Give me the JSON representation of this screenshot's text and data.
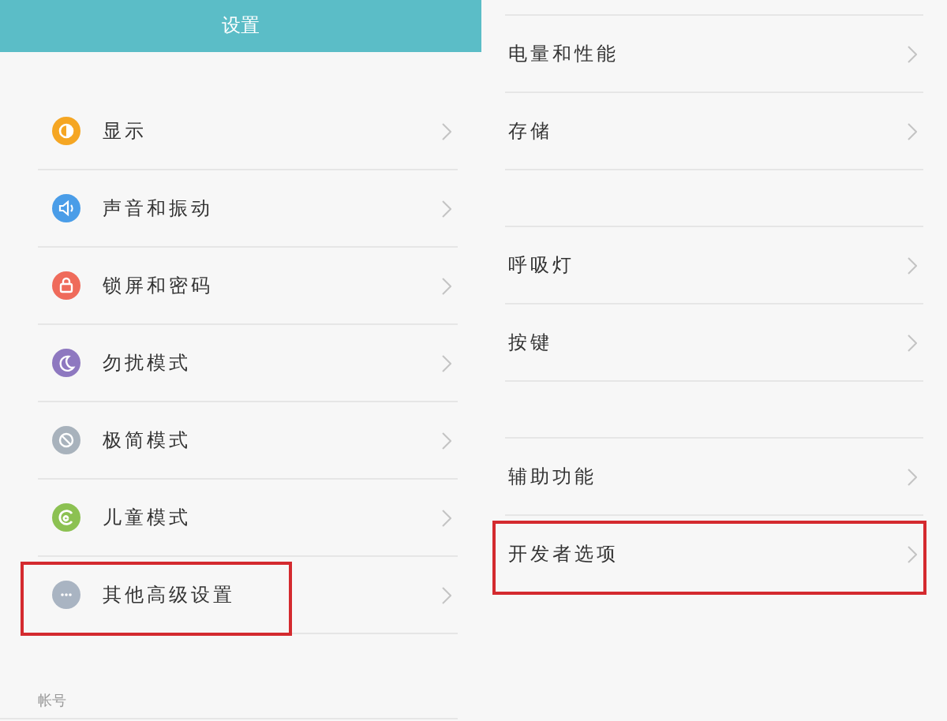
{
  "left": {
    "header": {
      "title": "设置"
    },
    "rows": [
      {
        "label": "显示",
        "color": "#f5a623",
        "highlighted": false
      },
      {
        "label": "声音和振动",
        "color": "#4a9de8",
        "highlighted": false
      },
      {
        "label": "锁屏和密码",
        "color": "#ef6b5b",
        "highlighted": false
      },
      {
        "label": "勿扰模式",
        "color": "#8e78c0",
        "highlighted": false
      },
      {
        "label": "极简模式",
        "color": "#a8b2bc",
        "highlighted": false
      },
      {
        "label": "儿童模式",
        "color": "#8cc152",
        "highlighted": false
      },
      {
        "label": "其他高级设置",
        "color": "#a9b4c2",
        "highlighted": true
      }
    ],
    "section_label": "帐号"
  },
  "right": {
    "groups": [
      [
        {
          "label": "电量和性能",
          "highlighted": false
        },
        {
          "label": "存储",
          "highlighted": false
        }
      ],
      [
        {
          "label": "呼吸灯",
          "highlighted": false
        },
        {
          "label": "按键",
          "highlighted": false
        }
      ],
      [
        {
          "label": "辅助功能",
          "highlighted": false
        },
        {
          "label": "开发者选项",
          "highlighted": true
        }
      ]
    ]
  }
}
